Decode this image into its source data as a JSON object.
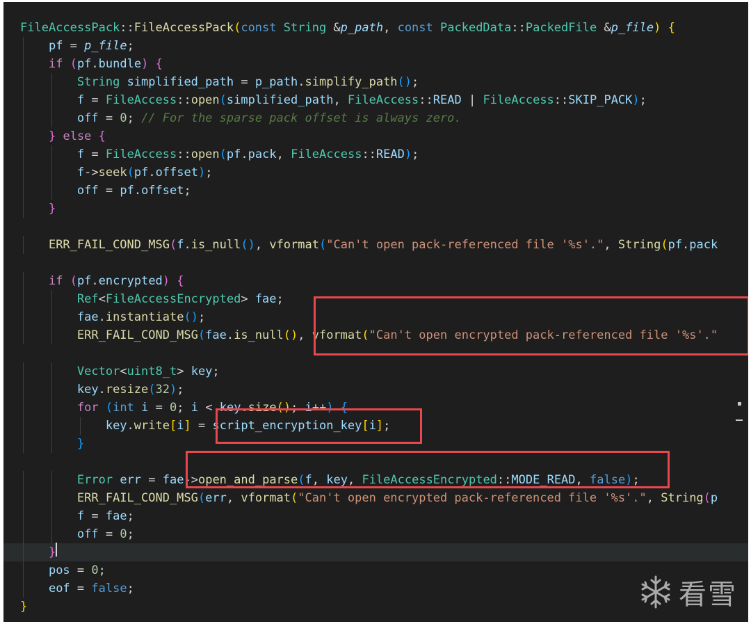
{
  "editor": {
    "theme_bg": "#1e1e1e",
    "highlight_color": "#e5484d"
  },
  "code": {
    "lines": [
      [
        [
          "FileAccessPack",
          "t-cls"
        ],
        [
          "::",
          "t-plain"
        ],
        [
          "FileAccessPack",
          "t-fn"
        ],
        [
          "(",
          "t-br1"
        ],
        [
          "const",
          "t-kw"
        ],
        [
          " ",
          "t-plain"
        ],
        [
          "String",
          "t-cls"
        ],
        [
          " &",
          "t-plain"
        ],
        [
          "p_path",
          "t-param"
        ],
        [
          ", ",
          "t-plain"
        ],
        [
          "const",
          "t-kw"
        ],
        [
          " ",
          "t-plain"
        ],
        [
          "PackedData",
          "t-cls"
        ],
        [
          "::",
          "t-plain"
        ],
        [
          "PackedFile",
          "t-cls"
        ],
        [
          " &",
          "t-plain"
        ],
        [
          "p_file",
          "t-param"
        ],
        [
          ")",
          "t-br1"
        ],
        [
          " ",
          "t-plain"
        ],
        [
          "{",
          "t-br1"
        ]
      ],
      [
        [
          "    "
        ],
        [
          "pf",
          "t-var"
        ],
        [
          " = ",
          "t-plain"
        ],
        [
          "p_file",
          "t-param"
        ],
        [
          ";",
          "t-plain"
        ]
      ],
      [
        [
          "    "
        ],
        [
          "if",
          "t-ctl"
        ],
        [
          " ",
          "t-plain"
        ],
        [
          "(",
          "t-br2"
        ],
        [
          "pf",
          "t-var"
        ],
        [
          ".",
          "t-plain"
        ],
        [
          "bundle",
          "t-var"
        ],
        [
          ")",
          "t-br2"
        ],
        [
          " ",
          "t-plain"
        ],
        [
          "{",
          "t-br2"
        ]
      ],
      [
        [
          "        "
        ],
        [
          "String",
          "t-cls"
        ],
        [
          " ",
          "t-plain"
        ],
        [
          "simplified_path",
          "t-var"
        ],
        [
          " = ",
          "t-plain"
        ],
        [
          "p_path",
          "t-var"
        ],
        [
          ".",
          "t-plain"
        ],
        [
          "simplify_path",
          "t-fn"
        ],
        [
          "()",
          "t-br3"
        ],
        [
          ";",
          "t-plain"
        ]
      ],
      [
        [
          "        "
        ],
        [
          "f",
          "t-var"
        ],
        [
          " = ",
          "t-plain"
        ],
        [
          "FileAccess",
          "t-cls"
        ],
        [
          "::",
          "t-plain"
        ],
        [
          "open",
          "t-fn"
        ],
        [
          "(",
          "t-br3"
        ],
        [
          "simplified_path",
          "t-var"
        ],
        [
          ", ",
          "t-plain"
        ],
        [
          "FileAccess",
          "t-cls"
        ],
        [
          "::",
          "t-plain"
        ],
        [
          "READ",
          "t-var"
        ],
        [
          " | ",
          "t-plain"
        ],
        [
          "FileAccess",
          "t-cls"
        ],
        [
          "::",
          "t-plain"
        ],
        [
          "SKIP_PACK",
          "t-var"
        ],
        [
          ")",
          "t-br3"
        ],
        [
          ";",
          "t-plain"
        ]
      ],
      [
        [
          "        "
        ],
        [
          "off",
          "t-var"
        ],
        [
          " = ",
          "t-plain"
        ],
        [
          "0",
          "t-num"
        ],
        [
          "; ",
          "t-plain"
        ],
        [
          "// For the sparse pack offset is always zero.",
          "t-cmt"
        ]
      ],
      [
        [
          "    "
        ],
        [
          "}",
          "t-br2"
        ],
        [
          " ",
          "t-plain"
        ],
        [
          "else",
          "t-ctl"
        ],
        [
          " ",
          "t-plain"
        ],
        [
          "{",
          "t-br2"
        ]
      ],
      [
        [
          "        "
        ],
        [
          "f",
          "t-var"
        ],
        [
          " = ",
          "t-plain"
        ],
        [
          "FileAccess",
          "t-cls"
        ],
        [
          "::",
          "t-plain"
        ],
        [
          "open",
          "t-fn"
        ],
        [
          "(",
          "t-br3"
        ],
        [
          "pf",
          "t-var"
        ],
        [
          ".",
          "t-plain"
        ],
        [
          "pack",
          "t-var"
        ],
        [
          ", ",
          "t-plain"
        ],
        [
          "FileAccess",
          "t-cls"
        ],
        [
          "::",
          "t-plain"
        ],
        [
          "READ",
          "t-var"
        ],
        [
          ")",
          "t-br3"
        ],
        [
          ";",
          "t-plain"
        ]
      ],
      [
        [
          "        "
        ],
        [
          "f",
          "t-var"
        ],
        [
          "->",
          "t-plain"
        ],
        [
          "seek",
          "t-fn"
        ],
        [
          "(",
          "t-br3"
        ],
        [
          "pf",
          "t-var"
        ],
        [
          ".",
          "t-plain"
        ],
        [
          "offset",
          "t-var"
        ],
        [
          ")",
          "t-br3"
        ],
        [
          ";",
          "t-plain"
        ]
      ],
      [
        [
          "        "
        ],
        [
          "off",
          "t-var"
        ],
        [
          " = ",
          "t-plain"
        ],
        [
          "pf",
          "t-var"
        ],
        [
          ".",
          "t-plain"
        ],
        [
          "offset",
          "t-var"
        ],
        [
          ";",
          "t-plain"
        ]
      ],
      [
        [
          "    "
        ],
        [
          "}",
          "t-br2"
        ]
      ],
      [
        [
          ""
        ]
      ],
      [
        [
          "    "
        ],
        [
          "ERR_FAIL_COND_MSG",
          "t-fn"
        ],
        [
          "(",
          "t-br2"
        ],
        [
          "f",
          "t-var"
        ],
        [
          ".",
          "t-plain"
        ],
        [
          "is_null",
          "t-fn"
        ],
        [
          "()",
          "t-br3"
        ],
        [
          ", ",
          "t-plain"
        ],
        [
          "vformat",
          "t-fn"
        ],
        [
          "(",
          "t-br3"
        ],
        [
          "\"Can't open pack-referenced file '%s'.\"",
          "t-str"
        ],
        [
          ", ",
          "t-plain"
        ],
        [
          "String",
          "t-fn"
        ],
        [
          "(",
          "t-br1"
        ],
        [
          "pf",
          "t-var"
        ],
        [
          ".",
          "t-plain"
        ],
        [
          "pack",
          "t-var"
        ]
      ],
      [
        [
          ""
        ]
      ],
      [
        [
          "    "
        ],
        [
          "if",
          "t-ctl"
        ],
        [
          " ",
          "t-plain"
        ],
        [
          "(",
          "t-br2"
        ],
        [
          "pf",
          "t-var"
        ],
        [
          ".",
          "t-plain"
        ],
        [
          "encrypted",
          "t-var"
        ],
        [
          ")",
          "t-br2"
        ],
        [
          " ",
          "t-plain"
        ],
        [
          "{",
          "t-br2"
        ]
      ],
      [
        [
          "        "
        ],
        [
          "Ref",
          "t-cls"
        ],
        [
          "<",
          "t-plain"
        ],
        [
          "FileAccessEncrypted",
          "t-cls"
        ],
        [
          "> ",
          "t-plain"
        ],
        [
          "fae",
          "t-var"
        ],
        [
          ";",
          "t-plain"
        ]
      ],
      [
        [
          "        "
        ],
        [
          "fae",
          "t-var"
        ],
        [
          ".",
          "t-plain"
        ],
        [
          "instantiate",
          "t-fn"
        ],
        [
          "()",
          "t-br3"
        ],
        [
          ";",
          "t-plain"
        ]
      ],
      [
        [
          "        "
        ],
        [
          "ERR_FAIL_COND_MSG",
          "t-fn"
        ],
        [
          "(",
          "t-br3"
        ],
        [
          "fae",
          "t-var"
        ],
        [
          ".",
          "t-plain"
        ],
        [
          "is_null",
          "t-fn"
        ],
        [
          "()",
          "t-br1"
        ],
        [
          ", ",
          "t-plain"
        ],
        [
          "vformat",
          "t-fn"
        ],
        [
          "(",
          "t-br1"
        ],
        [
          "\"Can't open encrypted pack-referenced file '%s'.\"",
          "t-str"
        ]
      ],
      [
        [
          ""
        ]
      ],
      [
        [
          "        "
        ],
        [
          "Vector",
          "t-cls"
        ],
        [
          "<",
          "t-plain"
        ],
        [
          "uint8_t",
          "t-cls"
        ],
        [
          "> ",
          "t-plain"
        ],
        [
          "key",
          "t-var"
        ],
        [
          ";",
          "t-plain"
        ]
      ],
      [
        [
          "        "
        ],
        [
          "key",
          "t-var"
        ],
        [
          ".",
          "t-plain"
        ],
        [
          "resize",
          "t-fn"
        ],
        [
          "(",
          "t-br3"
        ],
        [
          "32",
          "t-num"
        ],
        [
          ")",
          "t-br3"
        ],
        [
          ";",
          "t-plain"
        ]
      ],
      [
        [
          "        "
        ],
        [
          "for",
          "t-ctl"
        ],
        [
          " ",
          "t-plain"
        ],
        [
          "(",
          "t-br3"
        ],
        [
          "int",
          "t-kw"
        ],
        [
          " ",
          "t-plain"
        ],
        [
          "i",
          "t-var"
        ],
        [
          " = ",
          "t-plain"
        ],
        [
          "0",
          "t-num"
        ],
        [
          "; ",
          "t-plain"
        ],
        [
          "i",
          "t-var"
        ],
        [
          " < ",
          "t-plain"
        ],
        [
          "key",
          "t-var"
        ],
        [
          ".",
          "t-plain"
        ],
        [
          "size",
          "t-fn"
        ],
        [
          "()",
          "t-br1"
        ],
        [
          "; ",
          "t-plain"
        ],
        [
          "i",
          "t-var"
        ],
        [
          "++",
          "t-plain"
        ],
        [
          ")",
          "t-br3"
        ],
        [
          " ",
          "t-plain"
        ],
        [
          "{",
          "t-br3"
        ]
      ],
      [
        [
          "            "
        ],
        [
          "key",
          "t-var"
        ],
        [
          ".",
          "t-plain"
        ],
        [
          "write",
          "t-fn"
        ],
        [
          "[",
          "t-br1"
        ],
        [
          "i",
          "t-var"
        ],
        [
          "]",
          "t-br1"
        ],
        [
          " = ",
          "t-plain"
        ],
        [
          "script_encryption_key",
          "t-var"
        ],
        [
          "[",
          "t-br1"
        ],
        [
          "i",
          "t-var"
        ],
        [
          "]",
          "t-br1"
        ],
        [
          ";",
          "t-plain"
        ]
      ],
      [
        [
          "        "
        ],
        [
          "}",
          "t-br3"
        ]
      ],
      [
        [
          ""
        ]
      ],
      [
        [
          "        "
        ],
        [
          "Error",
          "t-cls"
        ],
        [
          " ",
          "t-plain"
        ],
        [
          "err",
          "t-var"
        ],
        [
          " = ",
          "t-plain"
        ],
        [
          "fae",
          "t-var"
        ],
        [
          "->",
          "t-plain"
        ],
        [
          "open_and_parse",
          "t-fn"
        ],
        [
          "(",
          "t-br3"
        ],
        [
          "f",
          "t-var"
        ],
        [
          ", ",
          "t-plain"
        ],
        [
          "key",
          "t-var"
        ],
        [
          ", ",
          "t-plain"
        ],
        [
          "FileAccessEncrypted",
          "t-cls"
        ],
        [
          "::",
          "t-plain"
        ],
        [
          "MODE_READ",
          "t-var"
        ],
        [
          ", ",
          "t-plain"
        ],
        [
          "false",
          "t-kw"
        ],
        [
          ")",
          "t-br3"
        ],
        [
          ";",
          "t-plain"
        ]
      ],
      [
        [
          "        "
        ],
        [
          "ERR_FAIL_COND_MSG",
          "t-fn"
        ],
        [
          "(",
          "t-br3"
        ],
        [
          "err",
          "t-var"
        ],
        [
          ", ",
          "t-plain"
        ],
        [
          "vformat",
          "t-fn"
        ],
        [
          "(",
          "t-br1"
        ],
        [
          "\"Can't open encrypted pack-referenced file '%s'.\"",
          "t-str"
        ],
        [
          ", ",
          "t-plain"
        ],
        [
          "String",
          "t-fn"
        ],
        [
          "(",
          "t-br2"
        ],
        [
          "p",
          "t-var"
        ]
      ],
      [
        [
          "        "
        ],
        [
          "f",
          "t-var"
        ],
        [
          " = ",
          "t-plain"
        ],
        [
          "fae",
          "t-var"
        ],
        [
          ";",
          "t-plain"
        ]
      ],
      [
        [
          "        "
        ],
        [
          "off",
          "t-var"
        ],
        [
          " = ",
          "t-plain"
        ],
        [
          "0",
          "t-num"
        ],
        [
          ";",
          "t-plain"
        ]
      ],
      [
        [
          "    "
        ],
        [
          "}",
          "t-br2"
        ]
      ],
      [
        [
          "    "
        ],
        [
          "pos",
          "t-var"
        ],
        [
          " = ",
          "t-plain"
        ],
        [
          "0",
          "t-num"
        ],
        [
          ";",
          "t-plain"
        ]
      ],
      [
        [
          "    "
        ],
        [
          "eof",
          "t-var"
        ],
        [
          " = ",
          "t-plain"
        ],
        [
          "false",
          "t-kw"
        ],
        [
          ";",
          "t-plain"
        ]
      ],
      [
        [
          "}",
          "t-br1"
        ]
      ]
    ],
    "current_line": 29
  },
  "watermark": {
    "icon": "snowflake-icon",
    "text": "看雪"
  }
}
